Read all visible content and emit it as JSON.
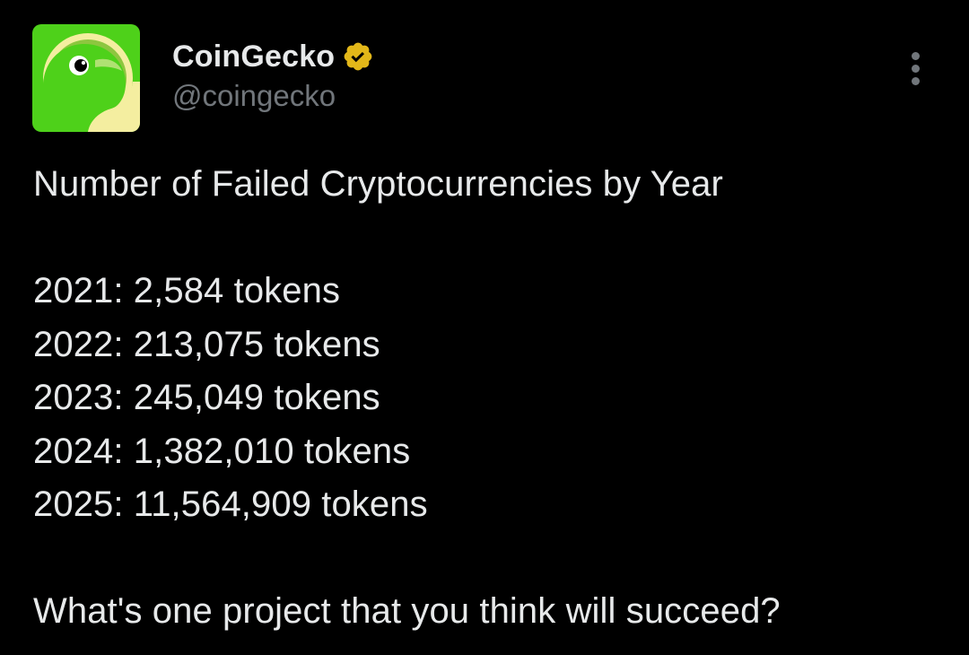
{
  "author": {
    "display_name": "CoinGecko",
    "handle": "@coingecko",
    "verified": true,
    "verified_badge": "verified-badge-icon",
    "avatar": "coingecko-logo"
  },
  "more_menu_icon": "more-vertical-icon",
  "tweet": {
    "title": "Number of Failed Cryptocurrencies by Year",
    "lines": [
      "2021: 2,584 tokens",
      "2022: 213,075 tokens",
      "2023: 245,049 tokens",
      "2024: 1,382,010 tokens",
      "2025: 11,564,909 tokens"
    ],
    "question": "What's one project that you think will succeed?"
  },
  "colors": {
    "background": "#000000",
    "text": "#e7e9ea",
    "secondary_text": "#71767b",
    "badge_gold": "#e2b719",
    "logo_green": "#8dc63f",
    "logo_bright_green": "#4ed11a",
    "logo_yellow": "#f8f2a4"
  }
}
